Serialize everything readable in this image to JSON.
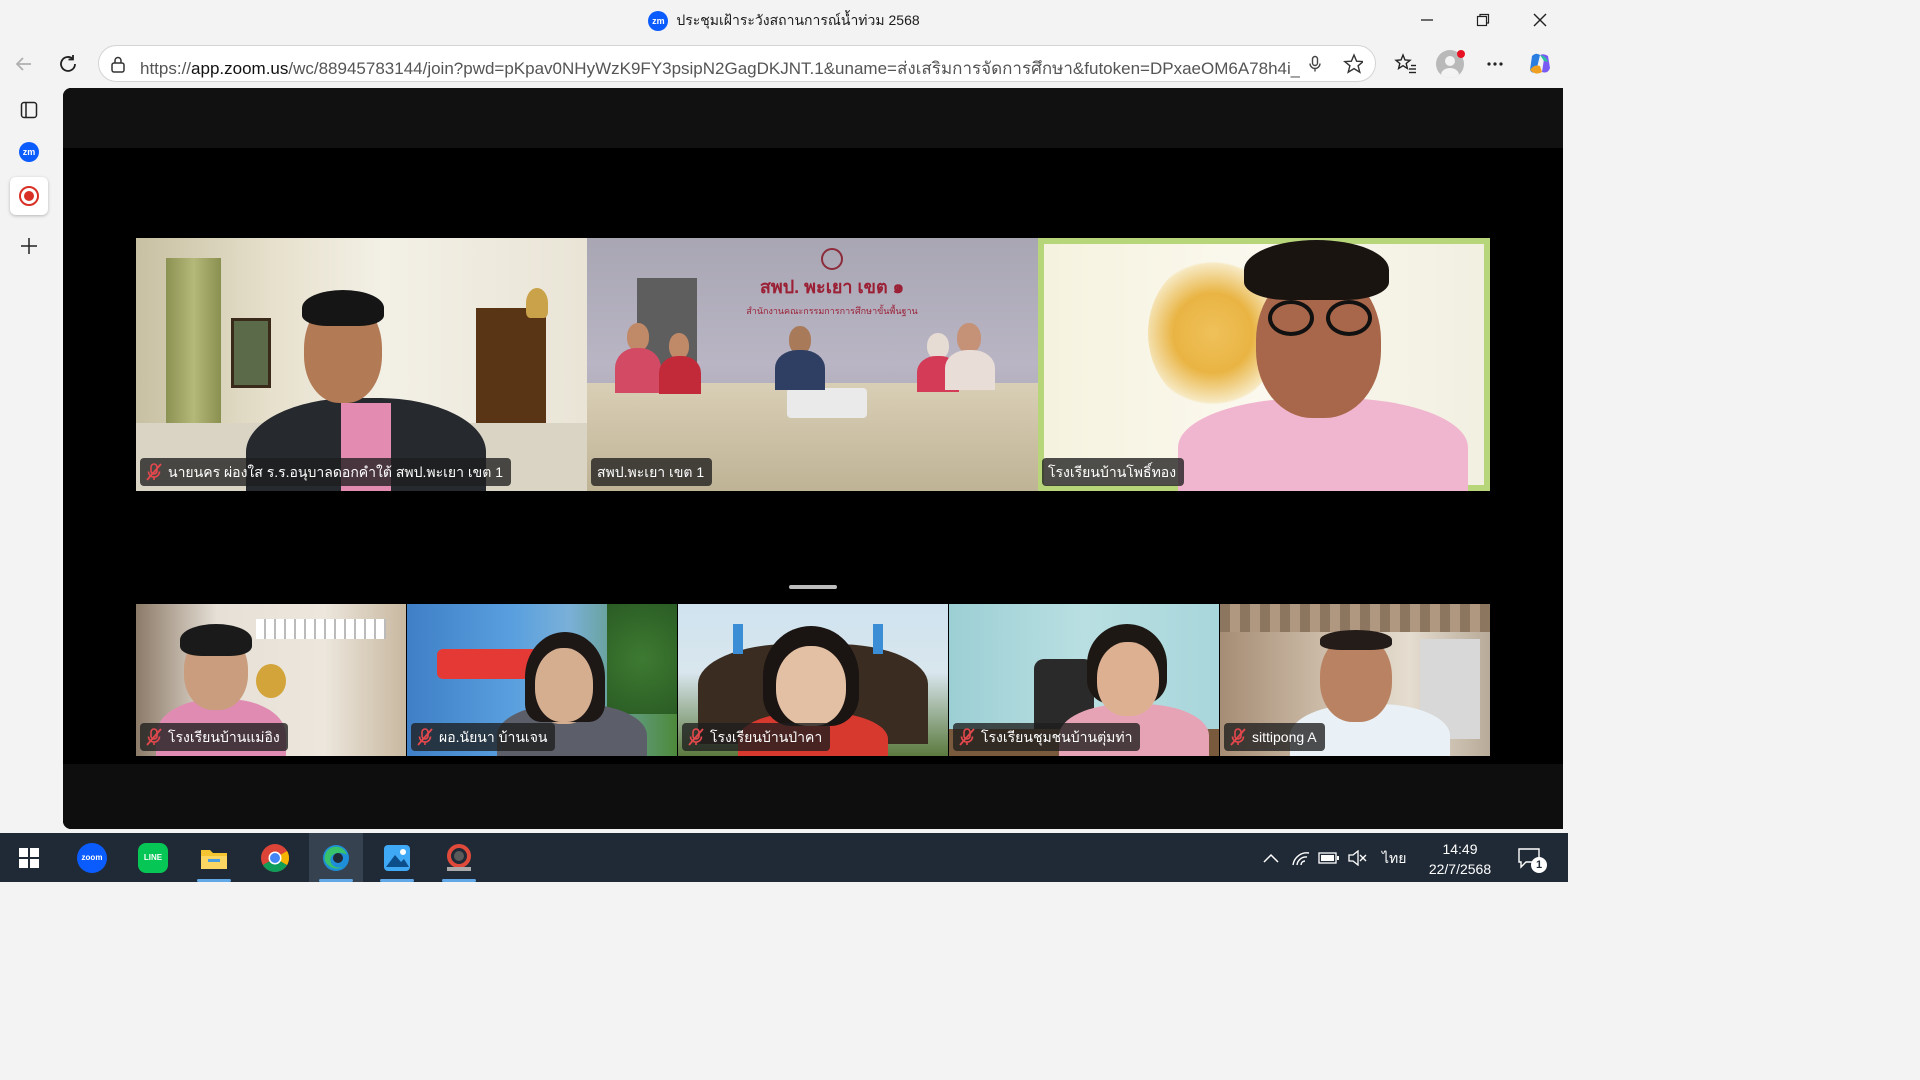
{
  "browser": {
    "tab_title": "ประชุมเฝ้าระวังสถานการณ์น้ำท่วม 2568",
    "tab_icon_text": "zm",
    "url_scheme": "https://",
    "url_host": "app.zoom.us",
    "url_rest": "/wc/88945783144/join?pwd=pKpav0NHyWzK9FY3psipN2GagDKJNT.1&uname=ส่งเสริมการจัดการศึกษา&futoken=DPxaeOM6A78h4i_...",
    "sidebar_zoom_label": "zm"
  },
  "meeting": {
    "top_tiles": [
      {
        "name": "นายนคร ผ่องใส ร.ร.อนุบาลดอกคำใต้ สพป.พะเยา เขต 1",
        "muted": true
      },
      {
        "name": "สพป.พะเยา เขต 1",
        "muted": false
      },
      {
        "name": "โรงเรียนบ้านโพธิ์ทอง",
        "muted": false
      }
    ],
    "bottom_tiles": [
      {
        "name": "โรงเรียนบ้านแม่อิง",
        "muted": true
      },
      {
        "name": "ผอ.นัยนา บ้านเจน",
        "muted": true
      },
      {
        "name": "โรงเรียนบ้านป่าคา",
        "muted": true
      },
      {
        "name": "โรงเรียนชุมชนบ้านตุ่มท่า",
        "muted": true
      },
      {
        "name": "sittipong A",
        "muted": true
      }
    ],
    "room_sign_title": "สพป. พะเยา เขต ๑",
    "room_sign_subtitle": "สำนักงานคณะกรรมการการศึกษาขั้นพื้นฐาน",
    "active_speaker_color": "#a8d45a"
  },
  "taskbar": {
    "apps": [
      "start-icon",
      "zoom-icon",
      "line-icon",
      "file-explorer-icon",
      "chrome-icon",
      "edge-icon",
      "photos-icon",
      "photocape-icon"
    ],
    "zoom_label": "zoom",
    "line_label": "LINE",
    "language": "ไทย",
    "time": "14:49",
    "date": "22/7/2568",
    "notification_count": "1"
  }
}
